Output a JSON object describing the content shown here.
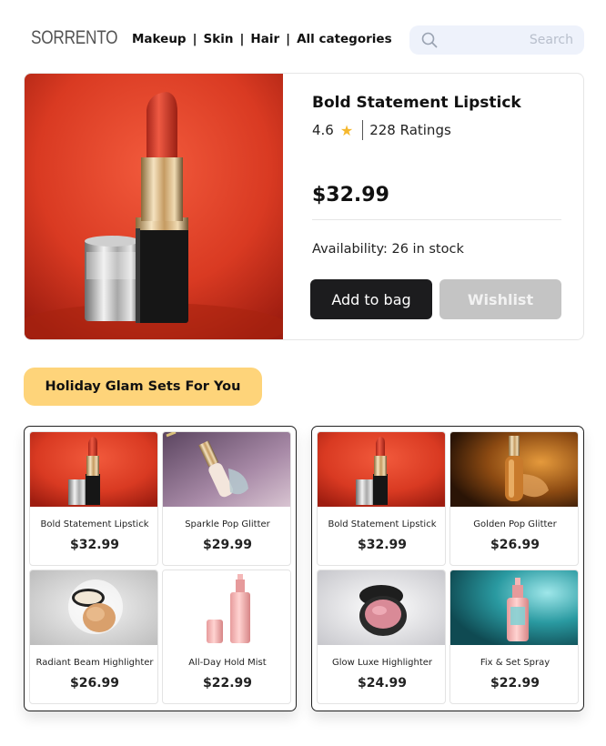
{
  "header": {
    "logo": "SORRENTO",
    "nav": [
      "Makeup",
      "Skin",
      "Hair",
      "All categories"
    ],
    "nav_separator": "|",
    "search_placeholder": "Search"
  },
  "product": {
    "title": "Bold Statement Lipstick",
    "rating": "4.6",
    "rating_icon": "star-icon",
    "ratings_count": "228 Ratings",
    "price": "$32.99",
    "availability": "Availability: 26 in stock",
    "add_to_bag_label": "Add to bag",
    "wishlist_label": "Wishlist"
  },
  "section": {
    "title": "Holiday Glam Sets For You"
  },
  "sets": [
    {
      "items": [
        {
          "name": "Bold Statement Lipstick",
          "price": "$32.99"
        },
        {
          "name": "Sparkle Pop Glitter",
          "price": "$29.99"
        },
        {
          "name": "Radiant Beam Highlighter",
          "price": "$26.99"
        },
        {
          "name": "All-Day Hold Mist",
          "price": "$22.99"
        }
      ]
    },
    {
      "items": [
        {
          "name": "Bold Statement Lipstick",
          "price": "$32.99"
        },
        {
          "name": "Golden Pop Glitter",
          "price": "$26.99"
        },
        {
          "name": "Glow Luxe Highlighter",
          "price": "$24.99"
        },
        {
          "name": "Fix & Set Spray",
          "price": "$22.99"
        }
      ]
    }
  ],
  "colors": {
    "accent_pill": "#fed47a",
    "primary_button": "#1c1c1e",
    "secondary_button": "#c4c4c4",
    "star": "#f5b82e"
  }
}
